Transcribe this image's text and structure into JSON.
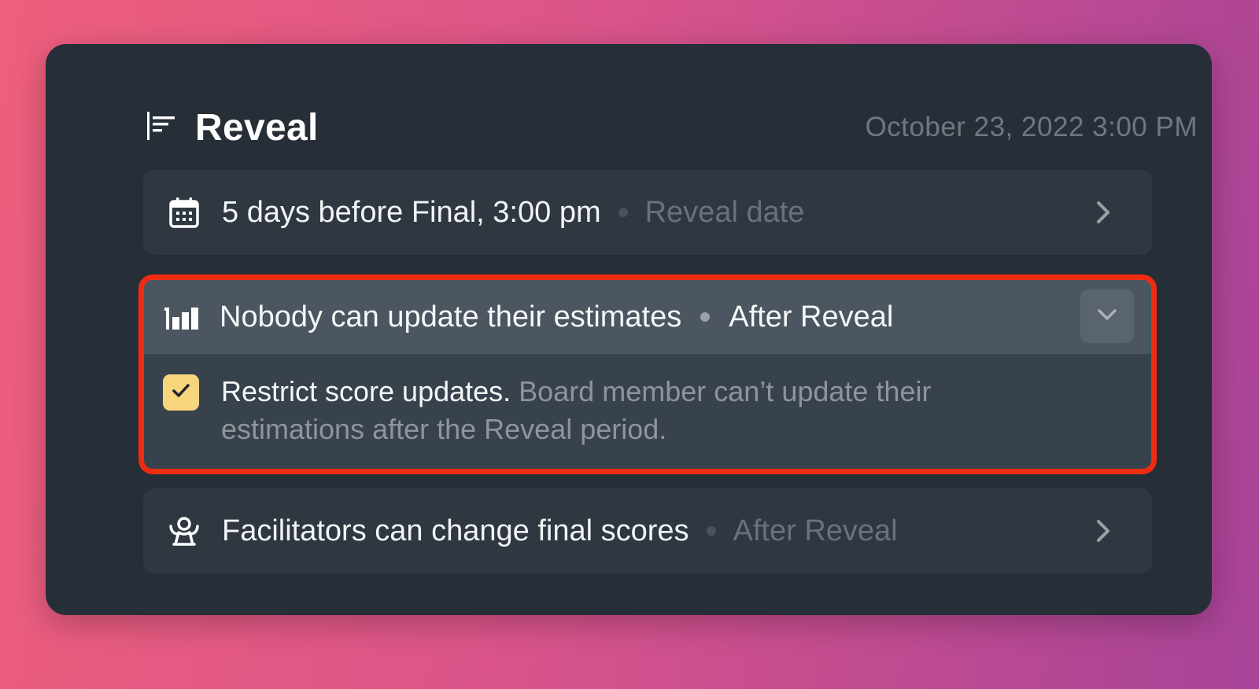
{
  "header": {
    "title": "Reveal",
    "datetime": "October 23, 2022 3:00 PM",
    "icon": "align-left-icon"
  },
  "rows": {
    "reveal_date": {
      "icon": "calendar-icon",
      "label": "5 days before Final, 3:00 pm",
      "sublabel": "Reveal date"
    },
    "estimates": {
      "icon": "bar-chart-icon",
      "label": "Nobody can update their estimates",
      "sublabel": "After Reveal",
      "expanded": true,
      "option": {
        "checked": true,
        "title": "Restrict score updates.",
        "description": "Board member can’t update their estimations after the Reveal period."
      }
    },
    "facilitators": {
      "icon": "facilitator-icon",
      "label": "Facilitators can change final scores",
      "sublabel": "After Reveal"
    }
  },
  "colors": {
    "highlight_border": "#ef2b12",
    "checkbox": "#f6d57c",
    "panel": "#262e37"
  }
}
